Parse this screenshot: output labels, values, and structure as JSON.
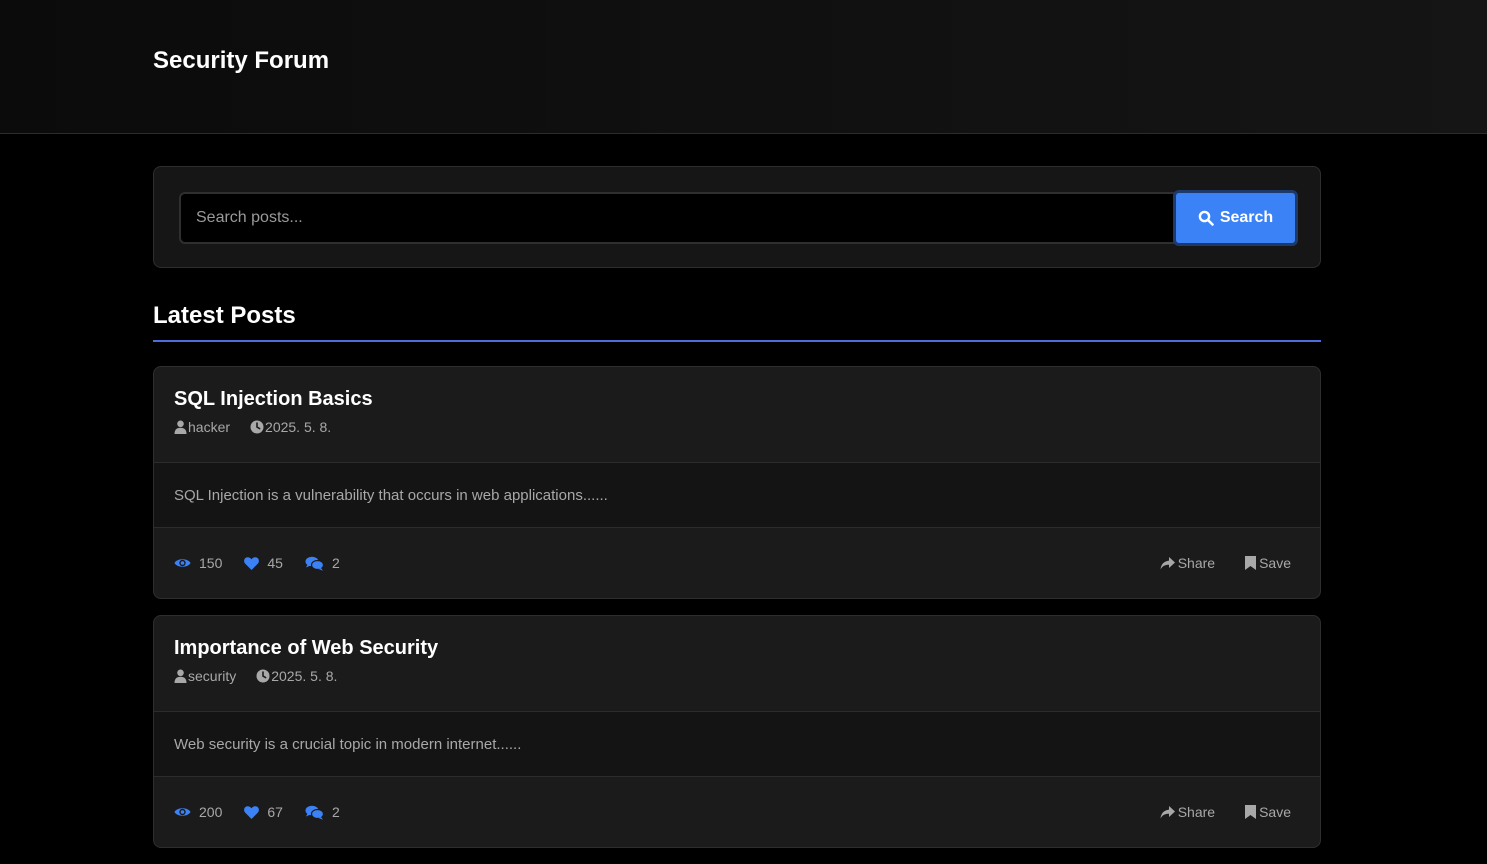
{
  "header": {
    "title": "Security Forum"
  },
  "search": {
    "placeholder": "Search posts...",
    "button_label": "Search"
  },
  "section": {
    "title": "Latest Posts"
  },
  "colors": {
    "accent": "#3b82f6",
    "divider": "#4f6bdc",
    "background": "#000000",
    "card": "#1b1b1b"
  },
  "posts": [
    {
      "title": "SQL Injection Basics",
      "author": "hacker",
      "date": "2025. 5. 8.",
      "excerpt": "SQL Injection is a vulnerability that occurs in web applications......",
      "views": "150",
      "likes": "45",
      "comments": "2",
      "share_label": "Share",
      "save_label": "Save"
    },
    {
      "title": "Importance of Web Security",
      "author": "security",
      "date": "2025. 5. 8.",
      "excerpt": "Web security is a crucial topic in modern internet......",
      "views": "200",
      "likes": "67",
      "comments": "2",
      "share_label": "Share",
      "save_label": "Save"
    }
  ]
}
